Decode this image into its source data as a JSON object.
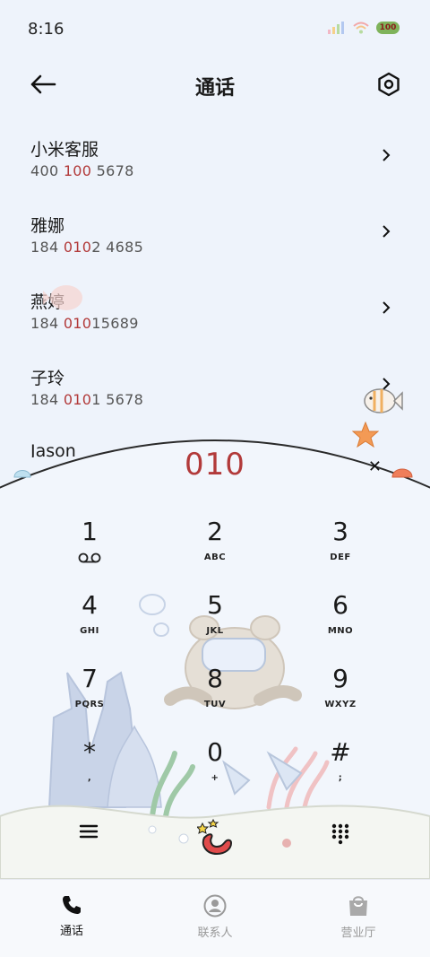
{
  "status_bar": {
    "time": "8:16",
    "battery": "100"
  },
  "header": {
    "title": "通话",
    "back_icon": "arrow-left-icon",
    "settings_icon": "settings-hexagon-icon"
  },
  "results": [
    {
      "name": "小米客服",
      "number_parts": [
        "400 ",
        "100",
        " 5678"
      ]
    },
    {
      "name": "雅娜",
      "number_parts": [
        "184 ",
        "010",
        "2 4685"
      ]
    },
    {
      "name": "燕婷",
      "number_parts": [
        "184 ",
        "010",
        "15689"
      ]
    },
    {
      "name": "子玲",
      "number_parts": [
        "184 ",
        "010",
        "1 5678"
      ]
    },
    {
      "name": "Jason",
      "number_parts": [
        "",
        "",
        ""
      ]
    }
  ],
  "dialer": {
    "number": "010",
    "keys": [
      {
        "digit": "1",
        "letters": "",
        "icon": "voicemail-icon"
      },
      {
        "digit": "2",
        "letters": "ABC"
      },
      {
        "digit": "3",
        "letters": "DEF"
      },
      {
        "digit": "4",
        "letters": "GHI"
      },
      {
        "digit": "5",
        "letters": "JKL"
      },
      {
        "digit": "6",
        "letters": "MNO"
      },
      {
        "digit": "7",
        "letters": "PQRS"
      },
      {
        "digit": "8",
        "letters": "TUV"
      },
      {
        "digit": "9",
        "letters": "WXYZ"
      },
      {
        "digit": "*",
        "letters": ","
      },
      {
        "digit": "0",
        "letters": "+"
      },
      {
        "digit": "#",
        "letters": ";"
      }
    ]
  },
  "bottom_nav": [
    {
      "label": "通话",
      "icon": "phone-icon",
      "active": true
    },
    {
      "label": "联系人",
      "icon": "contact-icon",
      "active": false
    },
    {
      "label": "营业厅",
      "icon": "bag-icon",
      "active": false
    }
  ],
  "colors": {
    "accent": "#b23a3a",
    "background": "#eef3fb"
  }
}
